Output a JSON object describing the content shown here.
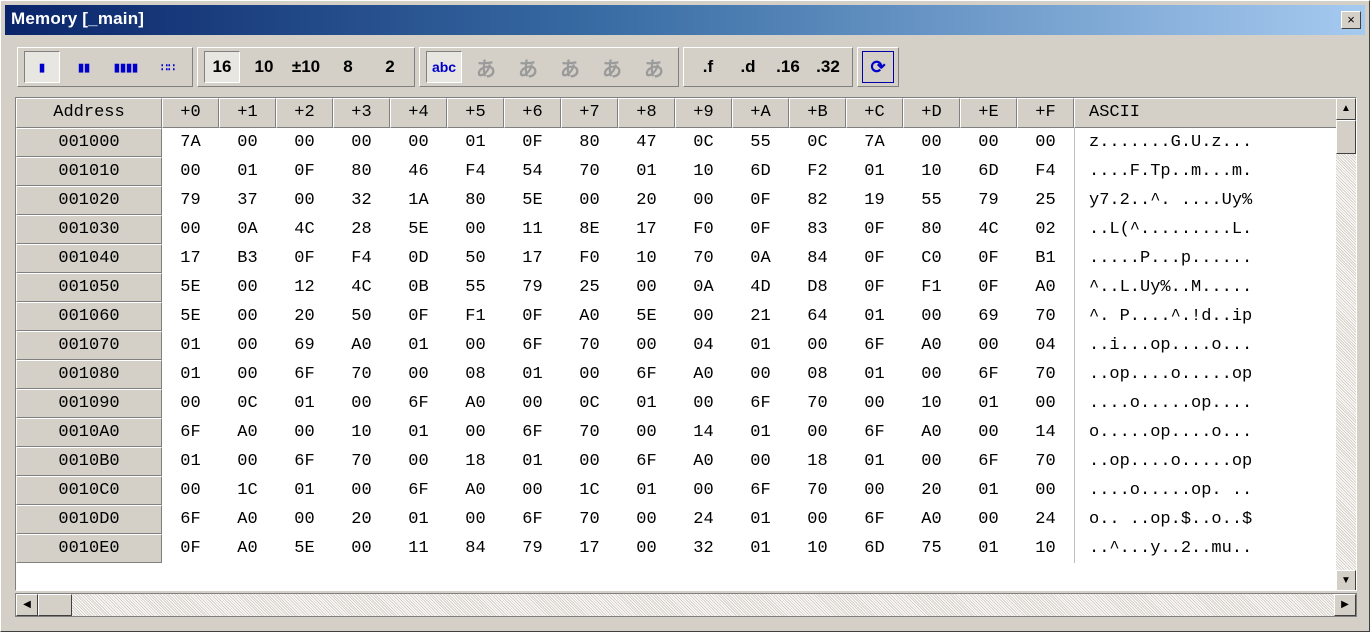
{
  "window": {
    "title": "Memory [_main]",
    "close_glyph": "×"
  },
  "toolbar": {
    "width_buttons": [
      {
        "name": "width-1-button",
        "glyph": "▮",
        "pressed": true
      },
      {
        "name": "width-2-button",
        "glyph": "▮▮",
        "pressed": false
      },
      {
        "name": "width-4-button",
        "glyph": "▮▮▮▮",
        "pressed": false
      },
      {
        "name": "width-8-button",
        "glyph": "∷∷",
        "pressed": false
      }
    ],
    "radix_buttons": [
      {
        "name": "radix-16-button",
        "label": "16",
        "pressed": true
      },
      {
        "name": "radix-10-button",
        "label": "10",
        "pressed": false
      },
      {
        "name": "radix-signed-10-button",
        "label": "±10",
        "pressed": false
      },
      {
        "name": "radix-8-button",
        "label": "8",
        "pressed": false
      },
      {
        "name": "radix-2-button",
        "label": "2",
        "pressed": false
      }
    ],
    "text_buttons": [
      {
        "name": "text-abc-button",
        "label": "abc",
        "pressed": true
      },
      {
        "name": "text-jp-1-button",
        "label": "あ",
        "pressed": false
      },
      {
        "name": "text-jp-2-button",
        "label": "あ",
        "pressed": false
      },
      {
        "name": "text-jp-3-button",
        "label": "あ",
        "pressed": false
      },
      {
        "name": "text-jp-4-button",
        "label": "あ",
        "pressed": false
      },
      {
        "name": "text-jp-5-button",
        "label": "あ",
        "pressed": false
      }
    ],
    "float_buttons": [
      {
        "name": "float-f-button",
        "label": ".f"
      },
      {
        "name": "float-d-button",
        "label": ".d"
      },
      {
        "name": "float-16-button",
        "label": ".16"
      },
      {
        "name": "float-32-button",
        "label": ".32"
      }
    ],
    "refresh_glyph": "⟳"
  },
  "table": {
    "address_header": "Address",
    "byte_headers": [
      "+0",
      "+1",
      "+2",
      "+3",
      "+4",
      "+5",
      "+6",
      "+7",
      "+8",
      "+9",
      "+A",
      "+B",
      "+C",
      "+D",
      "+E",
      "+F"
    ],
    "ascii_header": "ASCII",
    "rows": [
      {
        "address": "001000",
        "bytes": [
          "7A",
          "00",
          "00",
          "00",
          "00",
          "01",
          "0F",
          "80",
          "47",
          "0C",
          "55",
          "0C",
          "7A",
          "00",
          "00",
          "00"
        ],
        "ascii": "z.......G.U.z..."
      },
      {
        "address": "001010",
        "bytes": [
          "00",
          "01",
          "0F",
          "80",
          "46",
          "F4",
          "54",
          "70",
          "01",
          "10",
          "6D",
          "F2",
          "01",
          "10",
          "6D",
          "F4"
        ],
        "ascii": "....F.Tp..m...m."
      },
      {
        "address": "001020",
        "bytes": [
          "79",
          "37",
          "00",
          "32",
          "1A",
          "80",
          "5E",
          "00",
          "20",
          "00",
          "0F",
          "82",
          "19",
          "55",
          "79",
          "25"
        ],
        "ascii": "y7.2..^. ....Uy%"
      },
      {
        "address": "001030",
        "bytes": [
          "00",
          "0A",
          "4C",
          "28",
          "5E",
          "00",
          "11",
          "8E",
          "17",
          "F0",
          "0F",
          "83",
          "0F",
          "80",
          "4C",
          "02"
        ],
        "ascii": "..L(^.........L."
      },
      {
        "address": "001040",
        "bytes": [
          "17",
          "B3",
          "0F",
          "F4",
          "0D",
          "50",
          "17",
          "F0",
          "10",
          "70",
          "0A",
          "84",
          "0F",
          "C0",
          "0F",
          "B1"
        ],
        "ascii": ".....P...p......"
      },
      {
        "address": "001050",
        "bytes": [
          "5E",
          "00",
          "12",
          "4C",
          "0B",
          "55",
          "79",
          "25",
          "00",
          "0A",
          "4D",
          "D8",
          "0F",
          "F1",
          "0F",
          "A0"
        ],
        "ascii": "^..L.Uy%..M....."
      },
      {
        "address": "001060",
        "bytes": [
          "5E",
          "00",
          "20",
          "50",
          "0F",
          "F1",
          "0F",
          "A0",
          "5E",
          "00",
          "21",
          "64",
          "01",
          "00",
          "69",
          "70"
        ],
        "ascii": "^. P....^.!d..ip"
      },
      {
        "address": "001070",
        "bytes": [
          "01",
          "00",
          "69",
          "A0",
          "01",
          "00",
          "6F",
          "70",
          "00",
          "04",
          "01",
          "00",
          "6F",
          "A0",
          "00",
          "04"
        ],
        "ascii": "..i...op....o..."
      },
      {
        "address": "001080",
        "bytes": [
          "01",
          "00",
          "6F",
          "70",
          "00",
          "08",
          "01",
          "00",
          "6F",
          "A0",
          "00",
          "08",
          "01",
          "00",
          "6F",
          "70"
        ],
        "ascii": "..op....o.....op"
      },
      {
        "address": "001090",
        "bytes": [
          "00",
          "0C",
          "01",
          "00",
          "6F",
          "A0",
          "00",
          "0C",
          "01",
          "00",
          "6F",
          "70",
          "00",
          "10",
          "01",
          "00"
        ],
        "ascii": "....o.....op...."
      },
      {
        "address": "0010A0",
        "bytes": [
          "6F",
          "A0",
          "00",
          "10",
          "01",
          "00",
          "6F",
          "70",
          "00",
          "14",
          "01",
          "00",
          "6F",
          "A0",
          "00",
          "14"
        ],
        "ascii": "o.....op....o..."
      },
      {
        "address": "0010B0",
        "bytes": [
          "01",
          "00",
          "6F",
          "70",
          "00",
          "18",
          "01",
          "00",
          "6F",
          "A0",
          "00",
          "18",
          "01",
          "00",
          "6F",
          "70"
        ],
        "ascii": "..op....o.....op"
      },
      {
        "address": "0010C0",
        "bytes": [
          "00",
          "1C",
          "01",
          "00",
          "6F",
          "A0",
          "00",
          "1C",
          "01",
          "00",
          "6F",
          "70",
          "00",
          "20",
          "01",
          "00"
        ],
        "ascii": "....o.....op. .."
      },
      {
        "address": "0010D0",
        "bytes": [
          "6F",
          "A0",
          "00",
          "20",
          "01",
          "00",
          "6F",
          "70",
          "00",
          "24",
          "01",
          "00",
          "6F",
          "A0",
          "00",
          "24"
        ],
        "ascii": "o.. ..op.$..o..$"
      },
      {
        "address": "0010E0",
        "bytes": [
          "0F",
          "A0",
          "5E",
          "00",
          "11",
          "84",
          "79",
          "17",
          "00",
          "32",
          "01",
          "10",
          "6D",
          "75",
          "01",
          "10"
        ],
        "ascii": "..^...y..2..mu.."
      }
    ]
  },
  "scrollbars": {
    "up": "▲",
    "down": "▼",
    "left": "◀",
    "right": "▶"
  }
}
